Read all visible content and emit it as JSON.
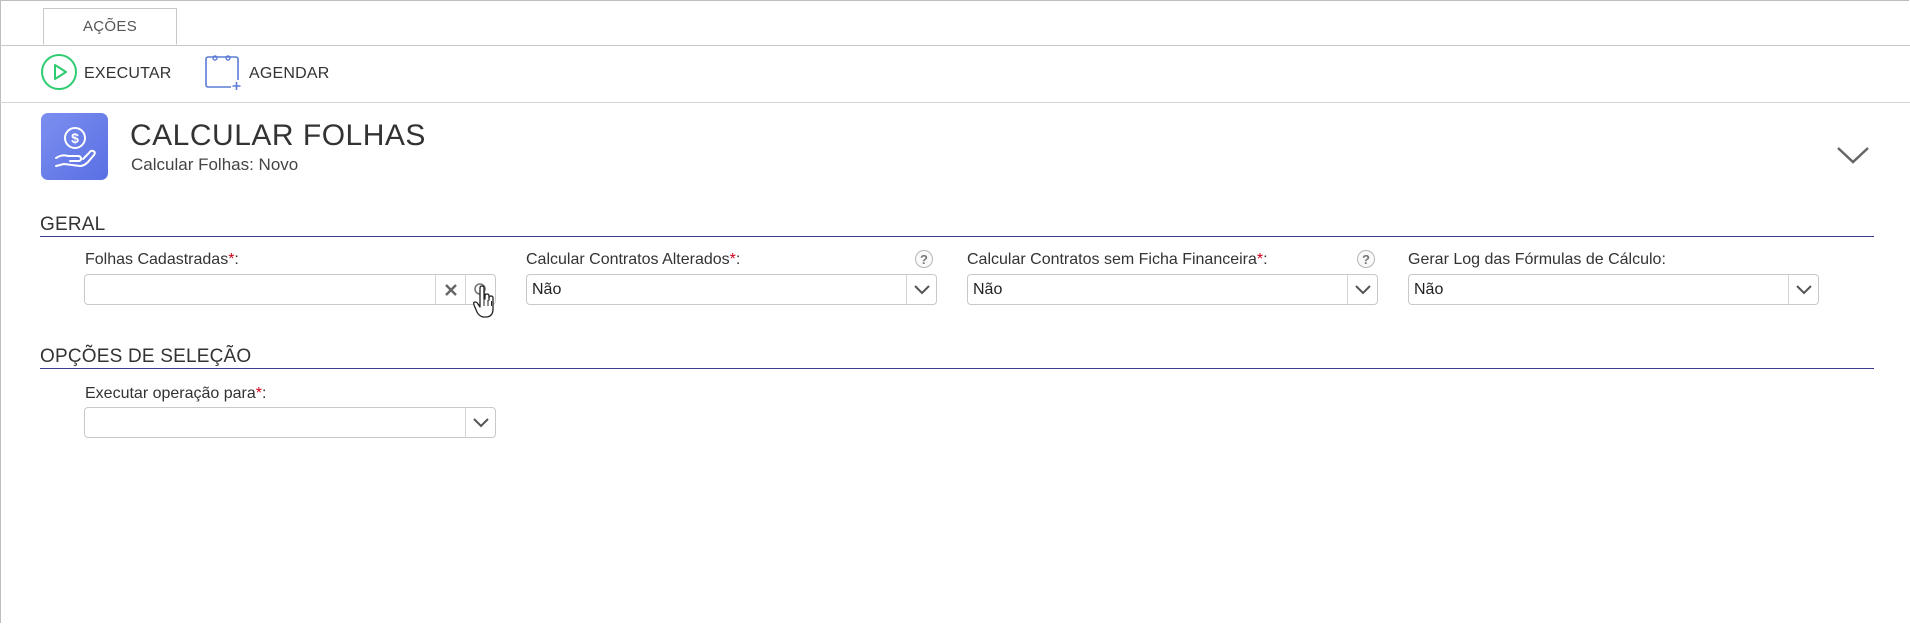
{
  "tabs": [
    {
      "label": "AÇÕES"
    }
  ],
  "toolbar": {
    "execute_label": "EXECUTAR",
    "schedule_label": "AGENDAR"
  },
  "header": {
    "title": "CALCULAR FOLHAS",
    "subtitle": "Calcular Folhas: Novo"
  },
  "sections": {
    "general": {
      "title": "GERAL",
      "fields": {
        "folhas": {
          "label": "Folhas Cadastradas",
          "required_mark": "*",
          "suffix": ":",
          "value": ""
        },
        "contratos_alterados": {
          "label": "Calcular Contratos Alterados",
          "required_mark": "*",
          "suffix": ":",
          "value": "Não",
          "help": "?"
        },
        "contratos_sem_ficha": {
          "label": "Calcular Contratos sem Ficha Financeira",
          "required_mark": "*",
          "suffix": ":",
          "value": "Não",
          "help": "?"
        },
        "gerar_log": {
          "label": "Gerar Log das Fórmulas de Cálculo:",
          "value": "Não"
        }
      }
    },
    "selection": {
      "title": "OPÇÕES DE SELEÇÃO",
      "fields": {
        "executar_para": {
          "label": "Executar operação para",
          "required_mark": "*",
          "suffix": ":",
          "value": ""
        }
      }
    }
  },
  "colors": {
    "section_line": "#3b3b8f",
    "required": "#d0021b",
    "execute_icon": "#2ecc71",
    "schedule_icon": "#5b7bd5",
    "app_icon_bg": "#6b7fea"
  }
}
